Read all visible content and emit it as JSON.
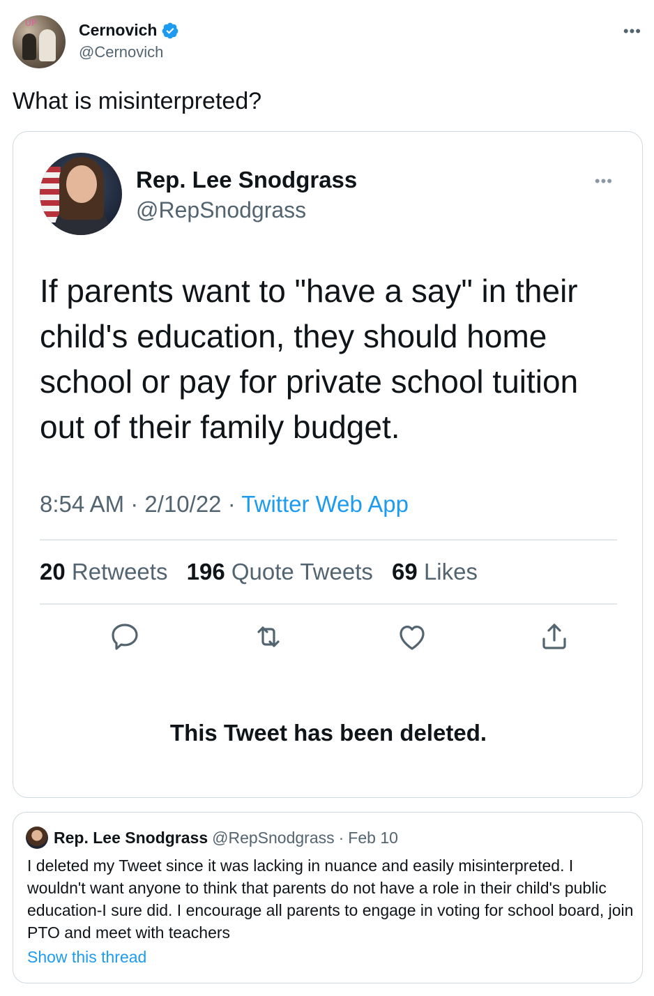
{
  "outer_tweet": {
    "author_name": "Cernovich",
    "author_handle": "@Cernovich",
    "more_label": "•••",
    "avatar_text": "UP",
    "text": "What is misinterpreted?"
  },
  "embedded_tweet": {
    "author_name": "Rep. Lee Snodgrass",
    "author_handle": "@RepSnodgrass",
    "more_label": "•••",
    "text_lines": [
      "If parents want to \"have a say\" in their",
      "child's education, they should home",
      "school or pay for private school tuition",
      "out of their family budget."
    ],
    "time": "8:54 AM",
    "date": "2/10/22",
    "separator": "·",
    "source": "Twitter Web App",
    "stats": {
      "retweets_count": "20",
      "retweets_label": "Retweets",
      "quotes_count": "196",
      "quotes_label": "Quote Tweets",
      "likes_count": "69",
      "likes_label": "Likes"
    },
    "actions": [
      "reply-icon",
      "retweet-icon",
      "like-icon",
      "share-icon"
    ],
    "deleted_notice": "This Tweet has been deleted."
  },
  "quoted_tweet": {
    "author_name": "Rep. Lee Snodgrass",
    "author_handle": "@RepSnodgrass",
    "separator": "·",
    "date": "Feb 10",
    "text": "I deleted my Tweet since it was lacking in nuance and easily misinterpreted. I wouldn't want anyone to think that parents do not have a role in their child's public education-I sure did. I encourage all parents to engage in voting for school board, join PTO and meet with teachers",
    "thread_link": "Show this thread"
  },
  "colors": {
    "text_primary": "#0f1419",
    "text_secondary": "#536471",
    "accent_blue": "#1d9bf0",
    "border": "#cfd9de"
  }
}
